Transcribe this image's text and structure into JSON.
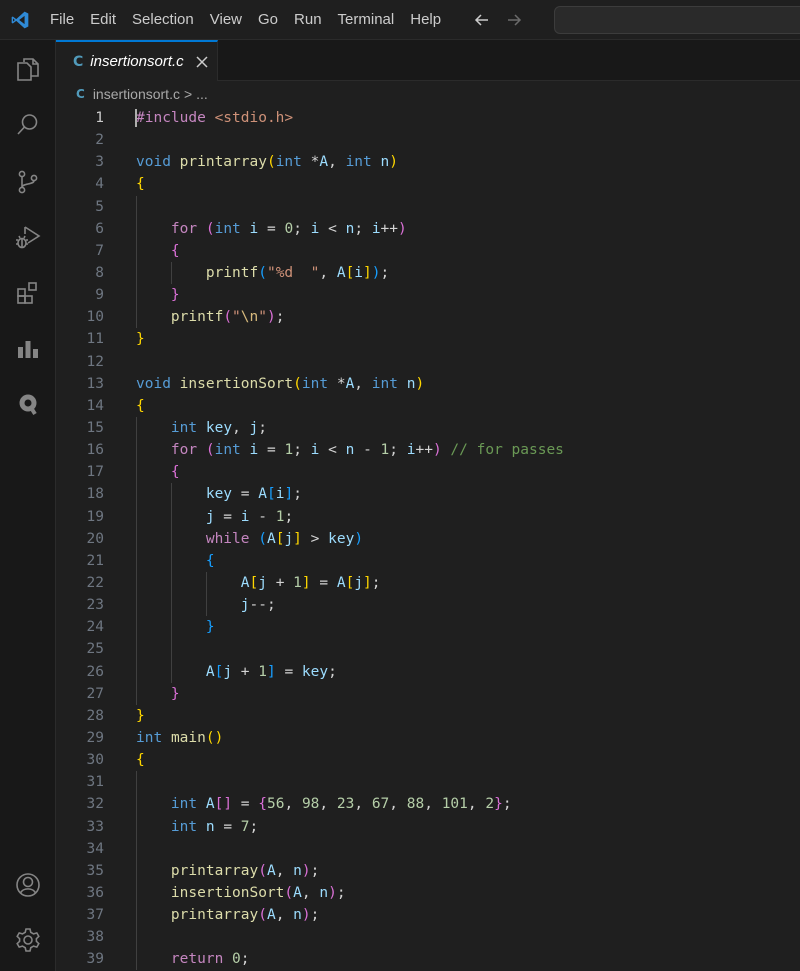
{
  "titlebar": {
    "menu": [
      "File",
      "Edit",
      "Selection",
      "View",
      "Go",
      "Run",
      "Terminal",
      "Help"
    ]
  },
  "activity_bar": {
    "top_icons": [
      "files-icon",
      "search-icon",
      "source-control-icon",
      "run-debug-icon",
      "extensions-icon",
      "charts-icon",
      "quokka-icon"
    ],
    "bottom_icons": [
      "account-icon",
      "settings-gear-icon"
    ]
  },
  "tab": {
    "lang_badge": "C",
    "label": "insertionsort.c"
  },
  "breadcrumb": {
    "lang_badge": "C",
    "file": "insertionsort.c",
    "separator": ">",
    "rest": "..."
  },
  "editor": {
    "active_line": 1,
    "lines": [
      {
        "n": "1",
        "indent": 0,
        "tokens": [
          [
            "pp",
            "#include"
          ],
          [
            "op",
            " "
          ],
          [
            "str",
            "<stdio.h>"
          ]
        ]
      },
      {
        "n": "2",
        "indent": 0,
        "tokens": []
      },
      {
        "n": "3",
        "indent": 0,
        "tokens": [
          [
            "kw",
            "void"
          ],
          [
            "op",
            " "
          ],
          [
            "fn",
            "printarray"
          ],
          [
            "b1",
            "("
          ],
          [
            "kw",
            "int"
          ],
          [
            "op",
            " *"
          ],
          [
            "var",
            "A"
          ],
          [
            "op",
            ", "
          ],
          [
            "kw",
            "int"
          ],
          [
            "op",
            " "
          ],
          [
            "var",
            "n"
          ],
          [
            "b1",
            ")"
          ]
        ]
      },
      {
        "n": "4",
        "indent": 0,
        "tokens": [
          [
            "b1",
            "{"
          ]
        ]
      },
      {
        "n": "5",
        "indent": 1,
        "tokens": []
      },
      {
        "n": "6",
        "indent": 1,
        "tokens": [
          [
            "op",
            "    "
          ],
          [
            "ctl",
            "for"
          ],
          [
            "op",
            " "
          ],
          [
            "b2",
            "("
          ],
          [
            "kw",
            "int"
          ],
          [
            "op",
            " "
          ],
          [
            "var",
            "i"
          ],
          [
            "op",
            " = "
          ],
          [
            "num",
            "0"
          ],
          [
            "op",
            "; "
          ],
          [
            "var",
            "i"
          ],
          [
            "op",
            " < "
          ],
          [
            "var",
            "n"
          ],
          [
            "op",
            "; "
          ],
          [
            "var",
            "i"
          ],
          [
            "op",
            "++"
          ],
          [
            "b2",
            ")"
          ]
        ]
      },
      {
        "n": "7",
        "indent": 1,
        "tokens": [
          [
            "op",
            "    "
          ],
          [
            "b2",
            "{"
          ]
        ]
      },
      {
        "n": "8",
        "indent": 2,
        "tokens": [
          [
            "op",
            "        "
          ],
          [
            "fn",
            "printf"
          ],
          [
            "b3",
            "("
          ],
          [
            "str",
            "\"%d  \""
          ],
          [
            "op",
            ", "
          ],
          [
            "var",
            "A"
          ],
          [
            "b1",
            "["
          ],
          [
            "var",
            "i"
          ],
          [
            "b1",
            "]"
          ],
          [
            "b3",
            ")"
          ],
          [
            "op",
            ";"
          ]
        ]
      },
      {
        "n": "9",
        "indent": 1,
        "tokens": [
          [
            "op",
            "    "
          ],
          [
            "b2",
            "}"
          ]
        ]
      },
      {
        "n": "10",
        "indent": 1,
        "tokens": [
          [
            "op",
            "    "
          ],
          [
            "fn",
            "printf"
          ],
          [
            "b2",
            "("
          ],
          [
            "str",
            "\""
          ],
          [
            "esc",
            "\\n"
          ],
          [
            "str",
            "\""
          ],
          [
            "b2",
            ")"
          ],
          [
            "op",
            ";"
          ]
        ]
      },
      {
        "n": "11",
        "indent": 0,
        "tokens": [
          [
            "b1",
            "}"
          ]
        ]
      },
      {
        "n": "12",
        "indent": 0,
        "tokens": []
      },
      {
        "n": "13",
        "indent": 0,
        "tokens": [
          [
            "kw",
            "void"
          ],
          [
            "op",
            " "
          ],
          [
            "fn",
            "insertionSort"
          ],
          [
            "b1",
            "("
          ],
          [
            "kw",
            "int"
          ],
          [
            "op",
            " *"
          ],
          [
            "var",
            "A"
          ],
          [
            "op",
            ", "
          ],
          [
            "kw",
            "int"
          ],
          [
            "op",
            " "
          ],
          [
            "var",
            "n"
          ],
          [
            "b1",
            ")"
          ]
        ]
      },
      {
        "n": "14",
        "indent": 0,
        "tokens": [
          [
            "b1",
            "{"
          ]
        ]
      },
      {
        "n": "15",
        "indent": 1,
        "tokens": [
          [
            "op",
            "    "
          ],
          [
            "kw",
            "int"
          ],
          [
            "op",
            " "
          ],
          [
            "var",
            "key"
          ],
          [
            "op",
            ", "
          ],
          [
            "var",
            "j"
          ],
          [
            "op",
            ";"
          ]
        ]
      },
      {
        "n": "16",
        "indent": 1,
        "tokens": [
          [
            "op",
            "    "
          ],
          [
            "ctl",
            "for"
          ],
          [
            "op",
            " "
          ],
          [
            "b2",
            "("
          ],
          [
            "kw",
            "int"
          ],
          [
            "op",
            " "
          ],
          [
            "var",
            "i"
          ],
          [
            "op",
            " = "
          ],
          [
            "num",
            "1"
          ],
          [
            "op",
            "; "
          ],
          [
            "var",
            "i"
          ],
          [
            "op",
            " < "
          ],
          [
            "var",
            "n"
          ],
          [
            "op",
            " - "
          ],
          [
            "num",
            "1"
          ],
          [
            "op",
            "; "
          ],
          [
            "var",
            "i"
          ],
          [
            "op",
            "++"
          ],
          [
            "b2",
            ")"
          ],
          [
            "op",
            " "
          ],
          [
            "cmt",
            "// for passes"
          ]
        ]
      },
      {
        "n": "17",
        "indent": 1,
        "tokens": [
          [
            "op",
            "    "
          ],
          [
            "b2",
            "{"
          ]
        ]
      },
      {
        "n": "18",
        "indent": 2,
        "tokens": [
          [
            "op",
            "        "
          ],
          [
            "var",
            "key"
          ],
          [
            "op",
            " = "
          ],
          [
            "var",
            "A"
          ],
          [
            "b3",
            "["
          ],
          [
            "var",
            "i"
          ],
          [
            "b3",
            "]"
          ],
          [
            "op",
            ";"
          ]
        ]
      },
      {
        "n": "19",
        "indent": 2,
        "tokens": [
          [
            "op",
            "        "
          ],
          [
            "var",
            "j"
          ],
          [
            "op",
            " = "
          ],
          [
            "var",
            "i"
          ],
          [
            "op",
            " - "
          ],
          [
            "num",
            "1"
          ],
          [
            "op",
            ";"
          ]
        ]
      },
      {
        "n": "20",
        "indent": 2,
        "tokens": [
          [
            "op",
            "        "
          ],
          [
            "ctl",
            "while"
          ],
          [
            "op",
            " "
          ],
          [
            "b3",
            "("
          ],
          [
            "var",
            "A"
          ],
          [
            "b1",
            "["
          ],
          [
            "var",
            "j"
          ],
          [
            "b1",
            "]"
          ],
          [
            "op",
            " > "
          ],
          [
            "var",
            "key"
          ],
          [
            "b3",
            ")"
          ]
        ]
      },
      {
        "n": "21",
        "indent": 2,
        "tokens": [
          [
            "op",
            "        "
          ],
          [
            "b3",
            "{"
          ]
        ]
      },
      {
        "n": "22",
        "indent": 3,
        "tokens": [
          [
            "op",
            "            "
          ],
          [
            "var",
            "A"
          ],
          [
            "b1",
            "["
          ],
          [
            "var",
            "j"
          ],
          [
            "op",
            " + "
          ],
          [
            "num",
            "1"
          ],
          [
            "b1",
            "]"
          ],
          [
            "op",
            " = "
          ],
          [
            "var",
            "A"
          ],
          [
            "b1",
            "["
          ],
          [
            "var",
            "j"
          ],
          [
            "b1",
            "]"
          ],
          [
            "op",
            ";"
          ]
        ]
      },
      {
        "n": "23",
        "indent": 3,
        "tokens": [
          [
            "op",
            "            "
          ],
          [
            "var",
            "j"
          ],
          [
            "op",
            "--;"
          ]
        ]
      },
      {
        "n": "24",
        "indent": 2,
        "tokens": [
          [
            "op",
            "        "
          ],
          [
            "b3",
            "}"
          ]
        ]
      },
      {
        "n": "25",
        "indent": 2,
        "tokens": []
      },
      {
        "n": "26",
        "indent": 2,
        "tokens": [
          [
            "op",
            "        "
          ],
          [
            "var",
            "A"
          ],
          [
            "b3",
            "["
          ],
          [
            "var",
            "j"
          ],
          [
            "op",
            " + "
          ],
          [
            "num",
            "1"
          ],
          [
            "b3",
            "]"
          ],
          [
            "op",
            " = "
          ],
          [
            "var",
            "key"
          ],
          [
            "op",
            ";"
          ]
        ]
      },
      {
        "n": "27",
        "indent": 1,
        "tokens": [
          [
            "op",
            "    "
          ],
          [
            "b2",
            "}"
          ]
        ]
      },
      {
        "n": "28",
        "indent": 0,
        "tokens": [
          [
            "b1",
            "}"
          ]
        ]
      },
      {
        "n": "29",
        "indent": 0,
        "tokens": [
          [
            "kw",
            "int"
          ],
          [
            "op",
            " "
          ],
          [
            "fn",
            "main"
          ],
          [
            "b1",
            "()"
          ]
        ]
      },
      {
        "n": "30",
        "indent": 0,
        "tokens": [
          [
            "b1",
            "{"
          ]
        ]
      },
      {
        "n": "31",
        "indent": 1,
        "tokens": []
      },
      {
        "n": "32",
        "indent": 1,
        "tokens": [
          [
            "op",
            "    "
          ],
          [
            "kw",
            "int"
          ],
          [
            "op",
            " "
          ],
          [
            "var",
            "A"
          ],
          [
            "b2",
            "[]"
          ],
          [
            "op",
            " = "
          ],
          [
            "b2",
            "{"
          ],
          [
            "num",
            "56"
          ],
          [
            "op",
            ", "
          ],
          [
            "num",
            "98"
          ],
          [
            "op",
            ", "
          ],
          [
            "num",
            "23"
          ],
          [
            "op",
            ", "
          ],
          [
            "num",
            "67"
          ],
          [
            "op",
            ", "
          ],
          [
            "num",
            "88"
          ],
          [
            "op",
            ", "
          ],
          [
            "num",
            "101"
          ],
          [
            "op",
            ", "
          ],
          [
            "num",
            "2"
          ],
          [
            "b2",
            "}"
          ],
          [
            "op",
            ";"
          ]
        ]
      },
      {
        "n": "33",
        "indent": 1,
        "tokens": [
          [
            "op",
            "    "
          ],
          [
            "kw",
            "int"
          ],
          [
            "op",
            " "
          ],
          [
            "var",
            "n"
          ],
          [
            "op",
            " = "
          ],
          [
            "num",
            "7"
          ],
          [
            "op",
            ";"
          ]
        ]
      },
      {
        "n": "34",
        "indent": 1,
        "tokens": []
      },
      {
        "n": "35",
        "indent": 1,
        "tokens": [
          [
            "op",
            "    "
          ],
          [
            "fn",
            "printarray"
          ],
          [
            "b2",
            "("
          ],
          [
            "var",
            "A"
          ],
          [
            "op",
            ", "
          ],
          [
            "var",
            "n"
          ],
          [
            "b2",
            ")"
          ],
          [
            "op",
            ";"
          ]
        ]
      },
      {
        "n": "36",
        "indent": 1,
        "tokens": [
          [
            "op",
            "    "
          ],
          [
            "fn",
            "insertionSort"
          ],
          [
            "b2",
            "("
          ],
          [
            "var",
            "A"
          ],
          [
            "op",
            ", "
          ],
          [
            "var",
            "n"
          ],
          [
            "b2",
            ")"
          ],
          [
            "op",
            ";"
          ]
        ]
      },
      {
        "n": "37",
        "indent": 1,
        "tokens": [
          [
            "op",
            "    "
          ],
          [
            "fn",
            "printarray"
          ],
          [
            "b2",
            "("
          ],
          [
            "var",
            "A"
          ],
          [
            "op",
            ", "
          ],
          [
            "var",
            "n"
          ],
          [
            "b2",
            ")"
          ],
          [
            "op",
            ";"
          ]
        ]
      },
      {
        "n": "38",
        "indent": 1,
        "tokens": []
      },
      {
        "n": "39",
        "indent": 1,
        "tokens": [
          [
            "op",
            "    "
          ],
          [
            "ctl",
            "return"
          ],
          [
            "op",
            " "
          ],
          [
            "num",
            "0"
          ],
          [
            "op",
            ";"
          ]
        ]
      }
    ]
  },
  "colors": {
    "accent": "#0078d4",
    "background": "#1f1f1f",
    "activity_bar": "#181818"
  }
}
